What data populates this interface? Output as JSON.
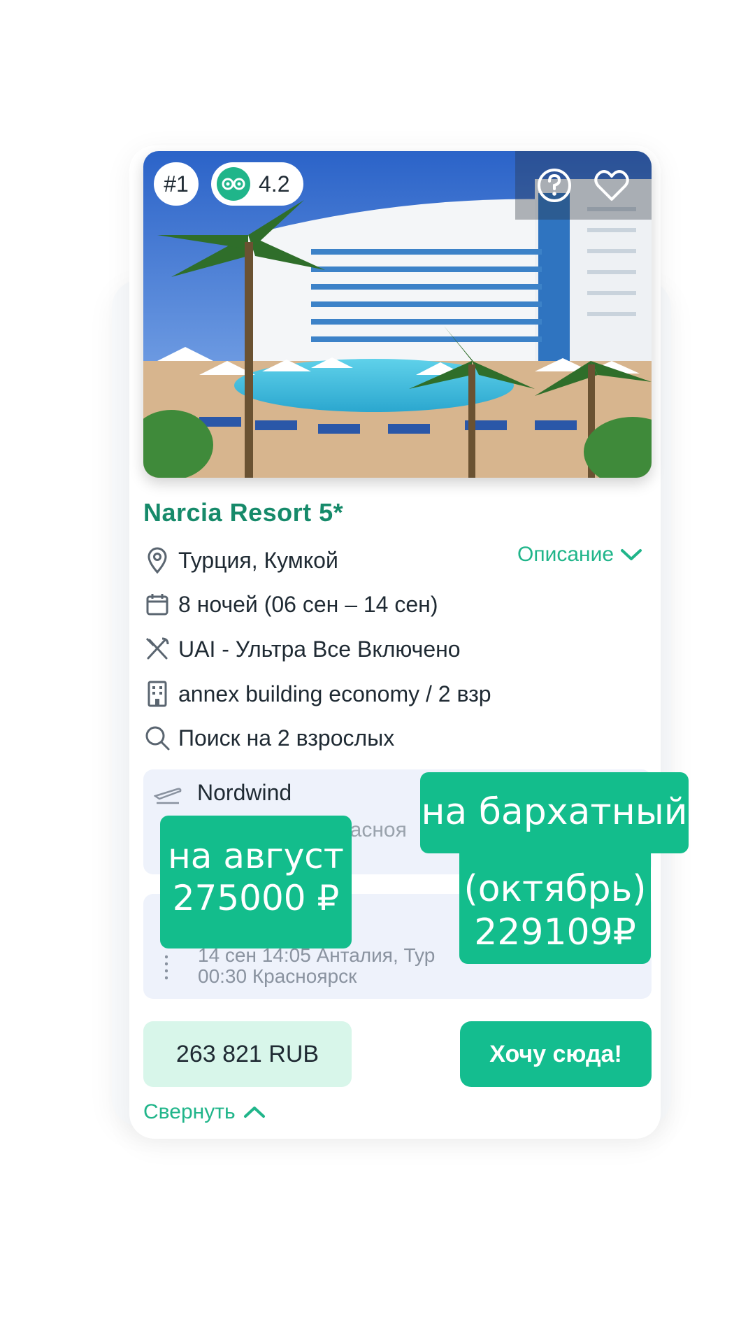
{
  "badges": {
    "rank": "#1",
    "rating": "4.2"
  },
  "hotel": {
    "name": "Narcia Resort 5*"
  },
  "details": {
    "location": "Турция, Кумкой",
    "description_link": "Описание",
    "nights": "8 ночей (06 сен – 14 сен)",
    "meal": "UAI - Ультра Все Включено",
    "room": "annex building economy / 2 взр",
    "search": "Поиск на 2 взрослых"
  },
  "flights": {
    "airline": "Nordwind",
    "route_partial": "расноя",
    "return_departure": "14 сен 14:05 Анталия, Тур",
    "return_arrival": "00:30 Красноярск"
  },
  "price": {
    "amount": "263 821 RUB",
    "cta": "Хочу сюда!"
  },
  "collapse_link": "Свернуть",
  "overlays": {
    "august_line1": "на август",
    "august_line2": "275000 ₽",
    "velvet_line1": "на бархатный",
    "velvet_line2": "(октябрь)",
    "velvet_line3": "229109₽"
  },
  "colors": {
    "accent": "#14bd8f",
    "accent_dark": "#168a6a",
    "price_bg": "#d8f6ea",
    "flight_bg": "#eef2fb"
  },
  "icons": [
    "question-icon",
    "heart-icon",
    "tripadvisor-icon",
    "location-pin-icon",
    "calendar-icon",
    "chevron-down-icon",
    "utensils-icon",
    "building-icon",
    "search-icon",
    "plane-icon",
    "chevron-up-icon"
  ]
}
